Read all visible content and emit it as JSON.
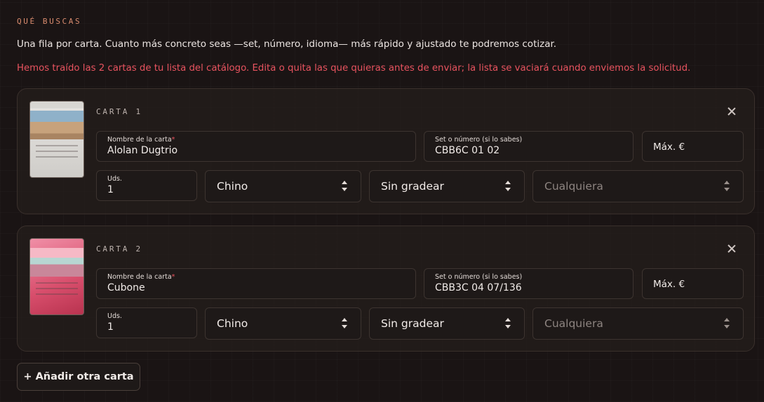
{
  "section_label": "QUÉ BUSCAS",
  "intro": "Una fila por carta. Cuanto más concreto seas —set, número, idioma— más rápido y ajustado te podremos cotizar.",
  "notice": "Hemos traído las 2 cartas de tu lista del catálogo. Edita o quita las que quieras antes de enviar; la lista se vaciará cuando enviemos la solicitud.",
  "colors": {
    "accent": "#d98b6e",
    "notice": "#e8535f",
    "background": "#1a1414"
  },
  "cards": [
    {
      "label": "CARTA 1",
      "name_label": "Nombre de la carta",
      "required_mark": "*",
      "name_value": "Alolan Dugtrio",
      "set_label": "Set o número (si lo sabes)",
      "set_value": "CBB6C 01 02",
      "max_price": "Máx. €",
      "qty_label": "Uds.",
      "qty_value": "1",
      "language": "Chino",
      "grading": "Sin gradear",
      "condition_placeholder": "Cualquiera"
    },
    {
      "label": "CARTA 2",
      "name_label": "Nombre de la carta",
      "required_mark": "*",
      "name_value": "Cubone",
      "set_label": "Set o número (si lo sabes)",
      "set_value": "CBB3C 04 07/136",
      "max_price": "Máx. €",
      "qty_label": "Uds.",
      "qty_value": "1",
      "language": "Chino",
      "grading": "Sin gradear",
      "condition_placeholder": "Cualquiera"
    }
  ],
  "add_button": "+ Añadir otra carta"
}
